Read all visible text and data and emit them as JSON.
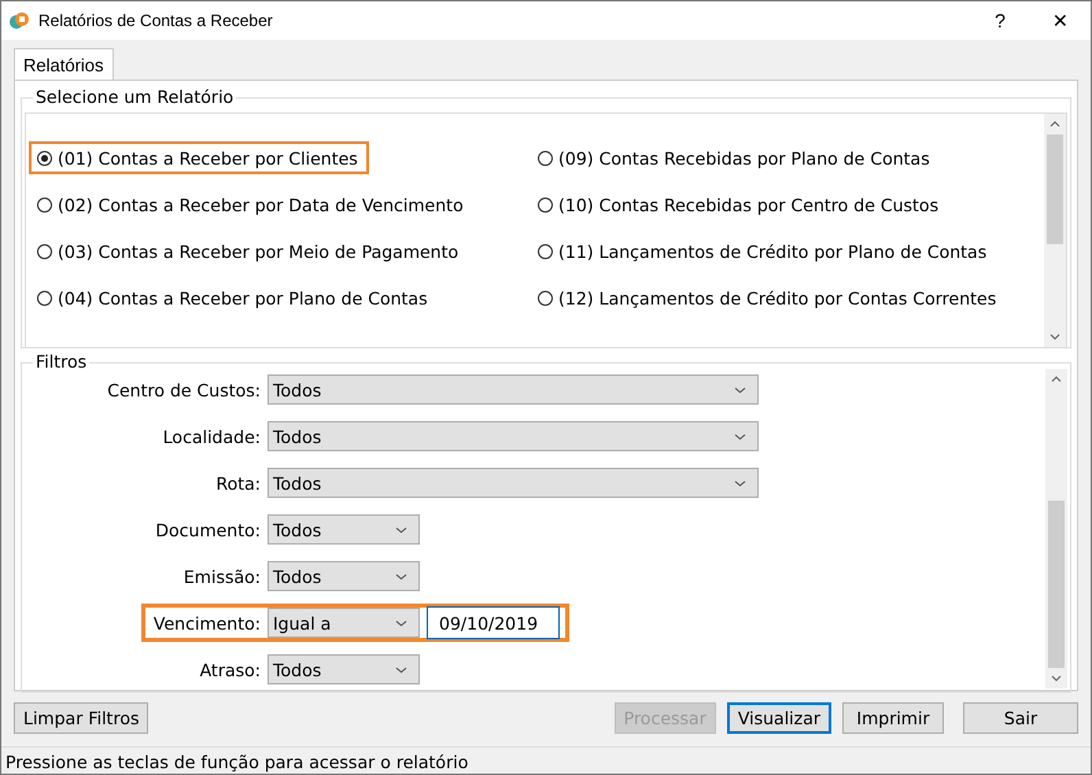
{
  "window": {
    "title": "Relatórios de Contas a Receber",
    "help": "?",
    "close": "✕"
  },
  "tabs": [
    {
      "label": "Relatórios",
      "selected": true
    }
  ],
  "report_group": {
    "title": "Selecione um Relatório",
    "columns": [
      [
        {
          "label": "(01) Contas a Receber por Clientes",
          "selected": true,
          "highlighted": true
        },
        {
          "label": "(02) Contas a Receber por Data de Vencimento",
          "selected": false,
          "highlighted": false
        },
        {
          "label": "(03) Contas a Receber por Meio de Pagamento",
          "selected": false,
          "highlighted": false
        },
        {
          "label": "(04) Contas a Receber por Plano de Contas",
          "selected": false,
          "highlighted": false
        }
      ],
      [
        {
          "label": "(09) Contas Recebidas por Plano de Contas",
          "selected": false,
          "highlighted": false
        },
        {
          "label": "(10) Contas Recebidas por Centro de Custos",
          "selected": false,
          "highlighted": false
        },
        {
          "label": "(11) Lançamentos de Crédito por Plano de Contas",
          "selected": false,
          "highlighted": false
        },
        {
          "label": "(12) Lançamentos de Crédito por Contas Correntes",
          "selected": false,
          "highlighted": false
        }
      ]
    ]
  },
  "filters_group": {
    "title": "Filtros",
    "filters": [
      {
        "label": "Centro de Custos:",
        "kind": "wide-select",
        "value": "Todos",
        "highlighted": false
      },
      {
        "label": "Localidade:",
        "kind": "wide-select",
        "value": "Todos",
        "highlighted": false
      },
      {
        "label": "Rota:",
        "kind": "wide-select",
        "value": "Todos",
        "highlighted": false
      },
      {
        "label": "Documento:",
        "kind": "select",
        "value": "Todos",
        "highlighted": false
      },
      {
        "label": "Emissão:",
        "kind": "select",
        "value": "Todos",
        "highlighted": false
      },
      {
        "label": "Vencimento:",
        "kind": "select-date",
        "value": "Igual a",
        "date": "09/10/2019",
        "highlighted": true
      },
      {
        "label": "Atraso:",
        "kind": "select",
        "value": "Todos",
        "highlighted": false
      }
    ]
  },
  "clear_button": {
    "label": "Limpar Filtros",
    "disabled": false,
    "focused": false
  },
  "buttons": [
    {
      "label": "Processar",
      "disabled": true,
      "focused": false
    },
    {
      "label": "Visualizar",
      "disabled": false,
      "focused": true
    },
    {
      "label": "Imprimir",
      "disabled": false,
      "focused": false
    },
    {
      "label": "Sair",
      "disabled": false,
      "focused": false
    }
  ],
  "status_bar": "Pressione as teclas de função para acessar o relatório"
}
